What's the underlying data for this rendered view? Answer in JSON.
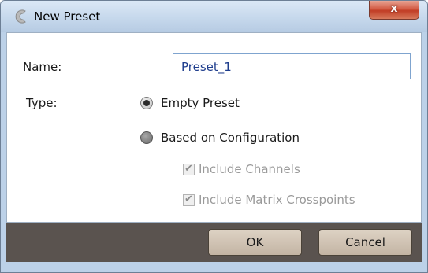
{
  "window": {
    "title": "New Preset",
    "close_glyph": "x"
  },
  "form": {
    "name_label": "Name:",
    "name_value": "Preset_1",
    "type_label": "Type:",
    "type_options": [
      {
        "label": "Empty Preset",
        "selected": true
      },
      {
        "label": "Based on Configuration",
        "selected": false
      }
    ],
    "sub_options": [
      {
        "label": "Include Channels",
        "checked": true,
        "enabled": false
      },
      {
        "label": "Include Matrix Crosspoints",
        "checked": true,
        "enabled": false
      }
    ]
  },
  "footer": {
    "ok_label": "OK",
    "cancel_label": "Cancel"
  },
  "colors": {
    "title_bar": "#c6d8ec",
    "footer": "#5a534f",
    "button": "#c9baa9",
    "close": "#c13d25"
  }
}
